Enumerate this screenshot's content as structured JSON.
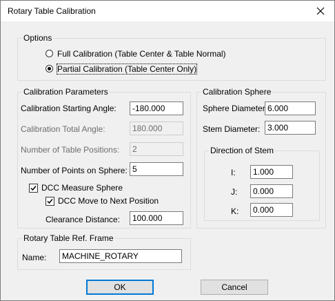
{
  "window": {
    "title": "Rotary Table Calibration"
  },
  "options": {
    "legend": "Options",
    "full_calibration": "Full Calibration (Table Center & Table Normal)",
    "partial_calibration": "Partial Calibration (Table Center Only)",
    "selected": "partial"
  },
  "params": {
    "legend": "Calibration Parameters",
    "start_angle_label": "Calibration Starting Angle:",
    "start_angle_value": "-180.000",
    "total_angle_label": "Calibration Total Angle:",
    "total_angle_value": "180.000",
    "positions_label": "Number of Table Positions:",
    "positions_value": "2",
    "points_label": "Number of Points on Sphere:",
    "points_value": "5",
    "dcc_measure_label": "DCC Measure Sphere",
    "dcc_measure_checked": true,
    "dcc_move_label": "DCC Move to Next Position",
    "dcc_move_checked": true,
    "clearance_label": "Clearance Distance:",
    "clearance_value": "100.000"
  },
  "sphere": {
    "legend": "Calibration Sphere",
    "diameter_label": "Sphere Diameter:",
    "diameter_value": "6.000",
    "stem_diameter_label": "Stem Diameter:",
    "stem_diameter_value": "3.000",
    "direction_legend": "Direction of Stem",
    "i_label": "I:",
    "i_value": "1.000",
    "j_label": "J:",
    "j_value": "0.000",
    "k_label": "K:",
    "k_value": "0.000"
  },
  "frame": {
    "legend": "Rotary Table Ref. Frame",
    "name_label": "Name:",
    "name_value": "MACHINE_ROTARY"
  },
  "buttons": {
    "ok": "OK",
    "cancel": "Cancel"
  },
  "colors": {
    "default_button_border": "#0078d7",
    "dialog_background": "#f0f0f0"
  }
}
